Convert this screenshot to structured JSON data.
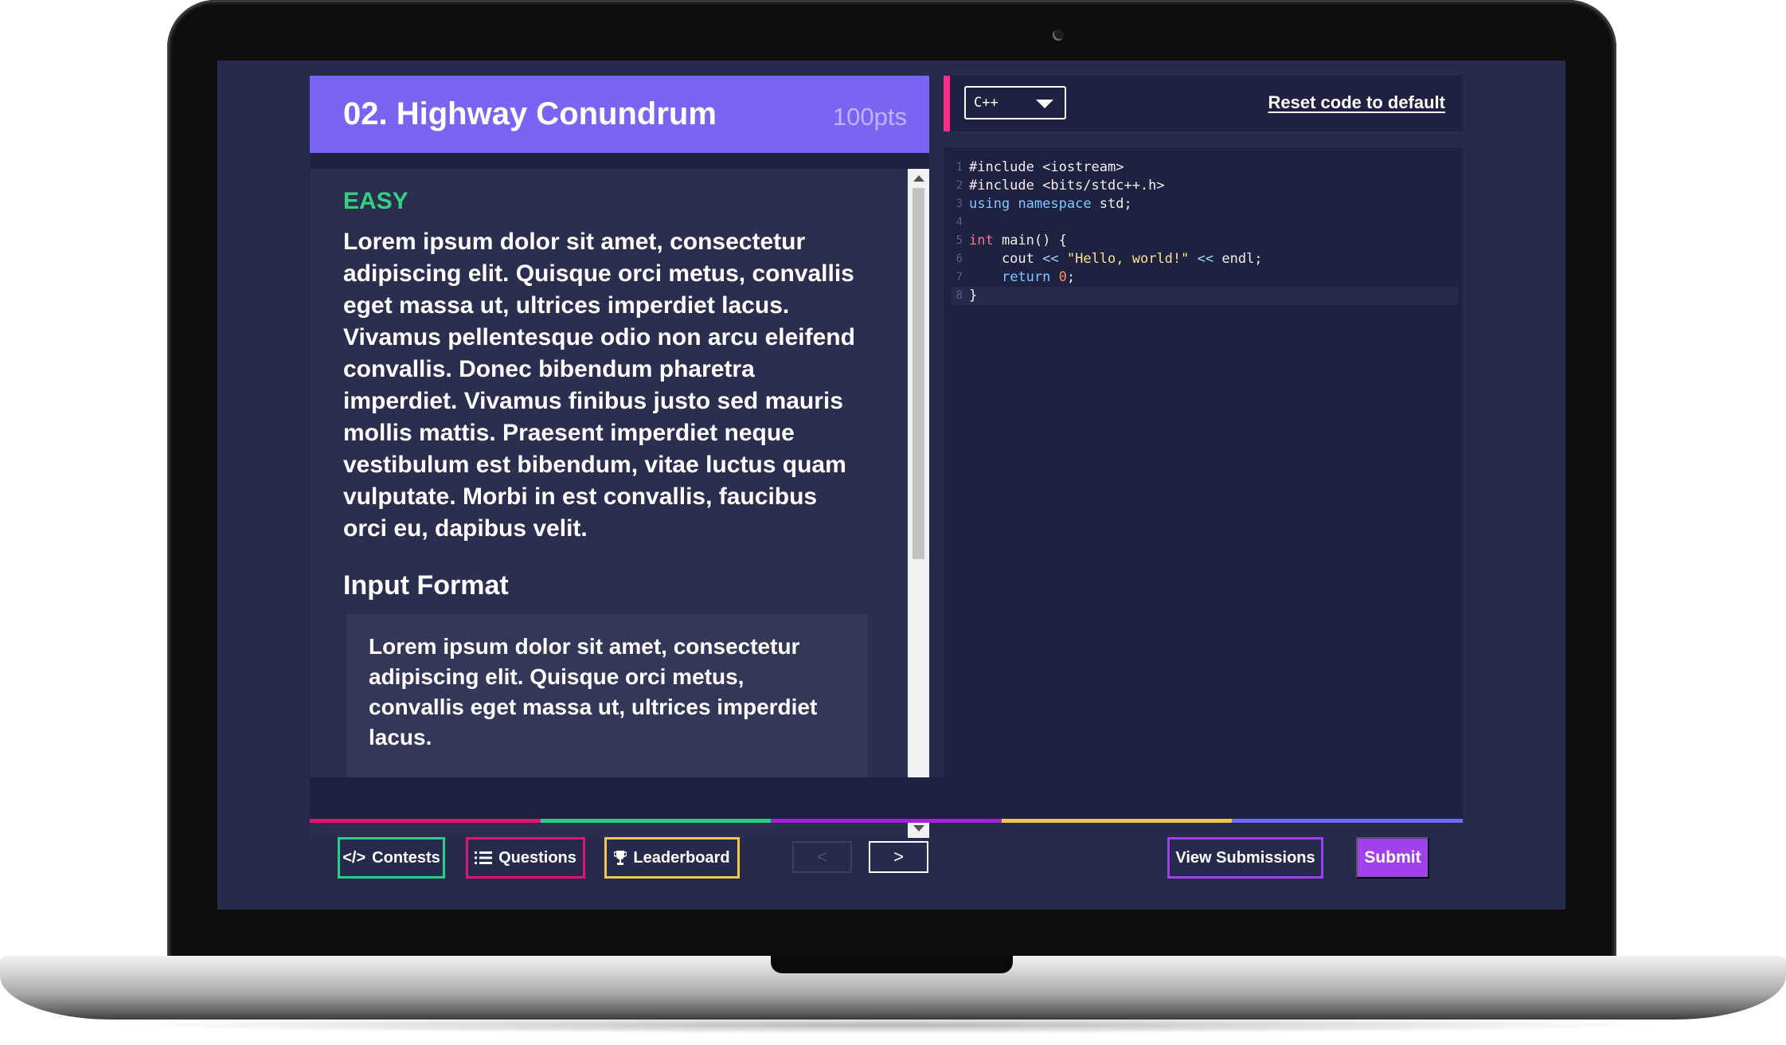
{
  "problem": {
    "title": "02. Highway Conundrum",
    "points": "100pts",
    "difficulty": "EASY",
    "description": "Lorem ipsum dolor sit amet, consectetur adipiscing elit. Quisque orci metus, convallis eget massa ut, ultrices imperdiet lacus. Vivamus pellentesque odio non arcu eleifend convallis. Donec bibendum pharetra imperdiet. Vivamus finibus justo sed mauris mollis mattis. Praesent imperdiet neque vestibulum est bibendum, vitae luctus quam vulputate. Morbi in est convallis, faucibus orci eu, dapibus velit.",
    "input_format_heading": "Input Format",
    "input_format_text": "Lorem ipsum dolor sit amet, consectetur adipiscing elit. Quisque orci metus, convallis eget massa ut, ultrices imperdiet lacus."
  },
  "editor": {
    "language": "C++",
    "reset_label": "Reset code to default",
    "line_numbers": [
      "1",
      "2",
      "3",
      "4",
      "5",
      "6",
      "7",
      "8"
    ],
    "code_lines": [
      "#include <iostream>",
      "#include <bits/stdc++.h>",
      "using namespace std;",
      "",
      "int main() {",
      "    cout << \"Hello, world!\" << endl;",
      "    return 0;",
      "}"
    ]
  },
  "footer": {
    "contests_icon": "</>",
    "contests_label": "Contests",
    "questions_icon": "list-icon",
    "questions_label": "Questions",
    "leaderboard_icon": "trophy-icon",
    "leaderboard_label": "Leaderboard",
    "prev_label": "<",
    "next_label": ">",
    "view_submissions_label": "View Submissions",
    "submit_label": "Submit"
  },
  "colors": {
    "accent_pink": "#ff2a87",
    "accent_green": "#35d07f",
    "accent_purple": "#a240ee",
    "accent_yellow": "#f2c84b",
    "accent_blue": "#6d6cf4",
    "header_purple": "#7a64f3",
    "background": "#262a4d"
  }
}
